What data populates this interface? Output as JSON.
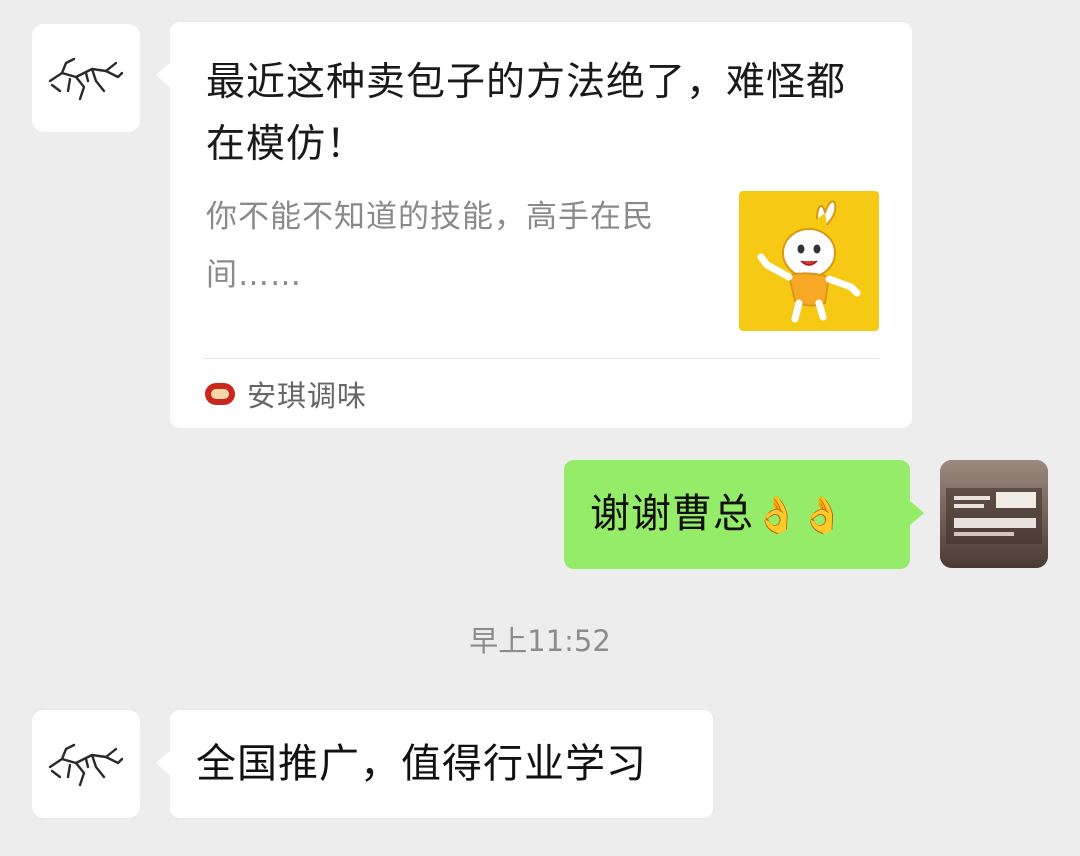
{
  "messages": {
    "link_card": {
      "title": "最近这种卖包子的方法绝了，难怪都在模仿！",
      "description": "你不能不知道的技能，高手在民间……",
      "source_name": "安琪调味",
      "thumbnail_icon": "baozi-mascot-icon",
      "sender_avatar": "bird-fossil-avatar"
    },
    "reply": {
      "text": "谢谢曹总",
      "emoji": "👌👌",
      "sender_avatar": "shortcut-sign-avatar"
    },
    "timestamp": "早上11:52",
    "last": {
      "text": "全国推广，值得行业学习",
      "sender_avatar": "bird-fossil-avatar"
    }
  },
  "colors": {
    "background": "#ededed",
    "incoming_bubble": "#ffffff",
    "outgoing_bubble": "#95ec69",
    "thumbnail_bg": "#f6c914"
  }
}
